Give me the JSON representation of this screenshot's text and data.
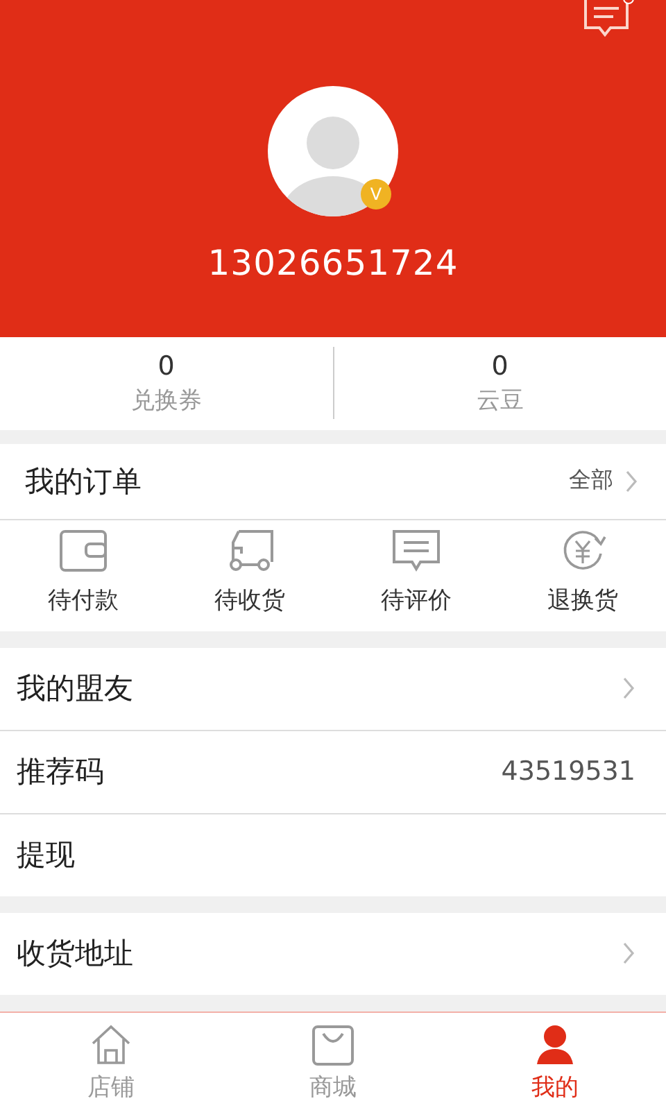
{
  "header": {
    "has_new_message": true,
    "verified": true,
    "verified_badge": "V",
    "phone": "13026651724"
  },
  "stats": [
    {
      "value": "0",
      "label": "兑换券"
    },
    {
      "value": "0",
      "label": "云豆"
    }
  ],
  "orders": {
    "title": "我的订单",
    "all_label": "全部",
    "items": [
      {
        "kind": "wallet",
        "label": "待付款"
      },
      {
        "kind": "truck",
        "label": "待收货"
      },
      {
        "kind": "comment",
        "label": "待评价"
      },
      {
        "kind": "refund",
        "label": "退换货"
      }
    ]
  },
  "menu_groups": [
    [
      {
        "kind": "link",
        "label": "我的盟友"
      },
      {
        "kind": "value",
        "label": "推荐码",
        "value": "43519531"
      },
      {
        "kind": "plain",
        "label": "提现"
      }
    ],
    [
      {
        "kind": "link",
        "label": "收货地址"
      }
    ]
  ],
  "tabs": [
    {
      "kind": "home",
      "label": "店铺",
      "selected": false
    },
    {
      "kind": "bag",
      "label": "商城",
      "selected": false
    },
    {
      "kind": "person",
      "label": "我的",
      "selected": true
    }
  ]
}
